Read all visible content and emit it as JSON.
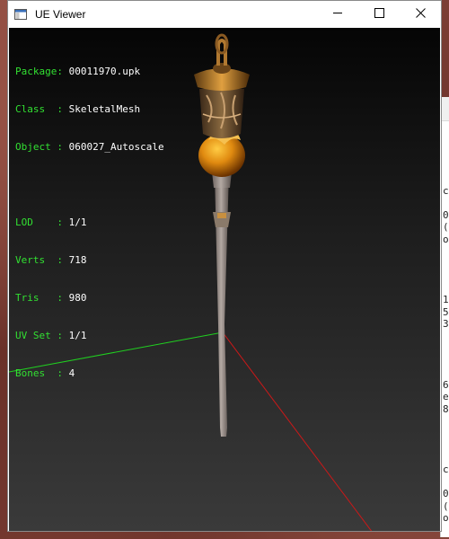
{
  "window": {
    "title": "UE Viewer"
  },
  "titlebar_icons": {
    "minimize": "minimize-icon",
    "maximize": "maximize-icon",
    "close": "close-icon"
  },
  "info": {
    "package_label": "Package:",
    "package_value": "00011970.upk",
    "class_label": "Class  :",
    "class_value": "SkeletalMesh",
    "object_label": "Object :",
    "object_value": "060027_Autoscale",
    "lod_label": "LOD    :",
    "lod_value": "1/1",
    "verts_label": "Verts  :",
    "verts_value": "718",
    "tris_label": "Tris   :",
    "tris_value": "980",
    "uvset_label": "UV Set :",
    "uvset_value": "1/1",
    "bones_label": "Bones  :",
    "bones_value": "4"
  },
  "background_window": {
    "text_lines": [
      "",
      "",
      "",
      "",
      "",
      "c",
      "",
      "0",
      "(",
      "o",
      "",
      "",
      "",
      "",
      "1",
      "5",
      "3",
      "",
      "",
      "",
      "",
      "6",
      "e",
      "8",
      "",
      "",
      "",
      "",
      "c",
      "",
      "0",
      "(",
      "o"
    ]
  },
  "colors": {
    "info_label": "#32e032",
    "info_value": "#ffffff",
    "axis_x": "#cc1818",
    "axis_y": "#20d020"
  }
}
